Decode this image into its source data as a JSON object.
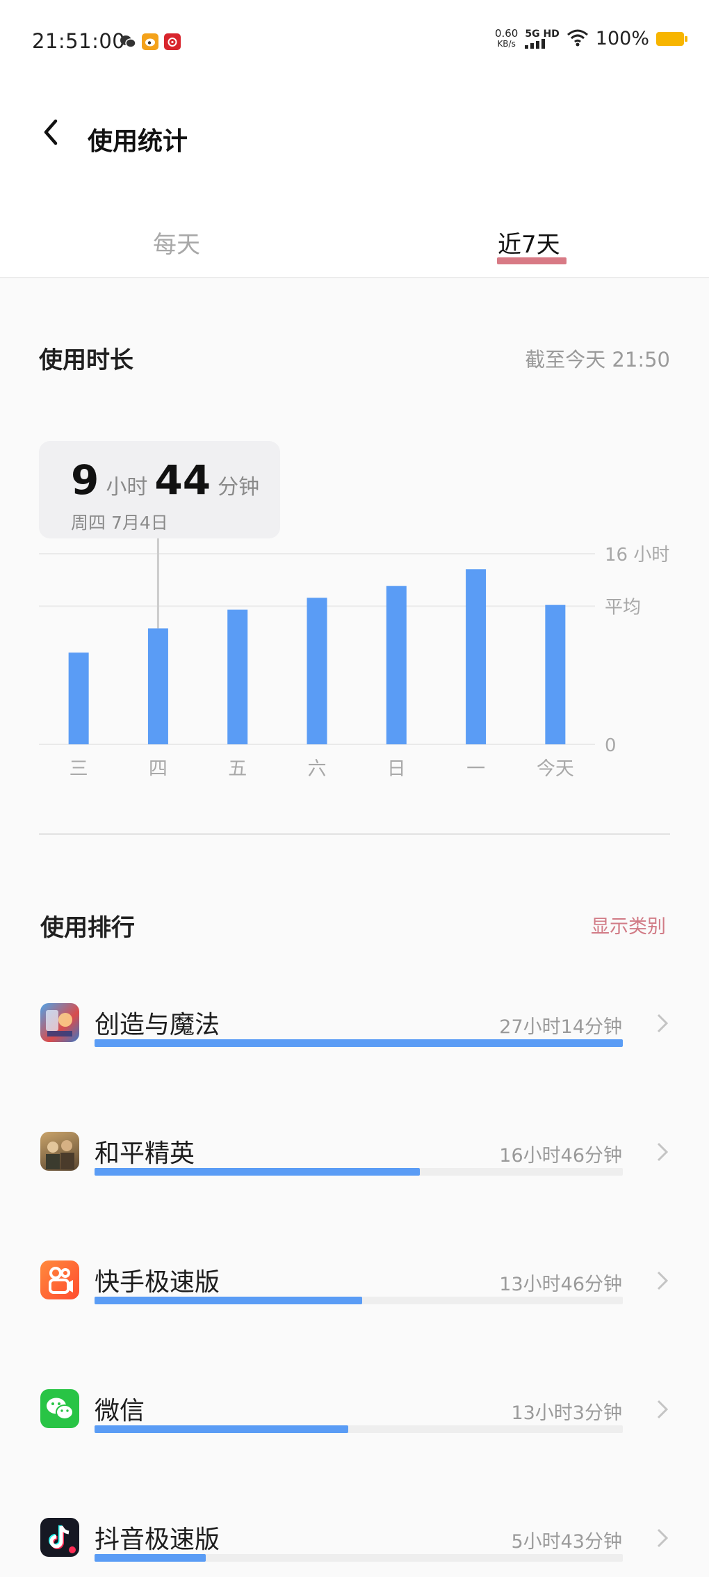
{
  "status_bar": {
    "time": "21:51:00",
    "net_speed_value": "0.60",
    "net_speed_unit": "KB/s",
    "network": "5G HD",
    "battery": "100%",
    "notification_icons": [
      "wechat-icon",
      "weibo-icon",
      "netease-music-icon"
    ]
  },
  "header": {
    "title": "使用统计"
  },
  "tabs": [
    {
      "label": "每天",
      "selected": false
    },
    {
      "label": "近7天",
      "selected": true
    }
  ],
  "usage": {
    "title": "使用时长",
    "as_of": "截至今天 21:50",
    "tooltip": {
      "hours": "9",
      "hours_unit": "小时",
      "minutes": "44",
      "minutes_unit": "分钟",
      "date": "周四 7月4日"
    }
  },
  "chart_data": {
    "type": "bar",
    "categories": [
      "三",
      "四",
      "五",
      "六",
      "日",
      "一",
      "今天"
    ],
    "values": [
      7.7,
      9.73,
      11.3,
      12.3,
      13.3,
      14.7,
      11.7
    ],
    "ylim": [
      0,
      16
    ],
    "y_labels": {
      "max": "16 小时",
      "average": "平均",
      "zero": "0"
    },
    "average": 11.6,
    "selected_index": 1,
    "bar_color": "#5a9cf5"
  },
  "ranking": {
    "title": "使用排行",
    "show_category": "显示类别",
    "apps": [
      {
        "name": "创造与魔法",
        "time": "27小时14分钟",
        "fraction": 1.0,
        "icon": "creation-magic-icon"
      },
      {
        "name": "和平精英",
        "time": "16小时46分钟",
        "fraction": 0.616,
        "icon": "peace-elite-icon"
      },
      {
        "name": "快手极速版",
        "time": "13小时46分钟",
        "fraction": 0.506,
        "icon": "kuaishou-lite-icon"
      },
      {
        "name": "微信",
        "time": "13小时3分钟",
        "fraction": 0.48,
        "icon": "wechat-icon"
      },
      {
        "name": "抖音极速版",
        "time": "5小时43分钟",
        "fraction": 0.21,
        "icon": "douyin-lite-icon"
      }
    ]
  },
  "colors": {
    "accent": "#d87a85",
    "bar": "#5a9cf5",
    "track": "#eeeeee"
  }
}
